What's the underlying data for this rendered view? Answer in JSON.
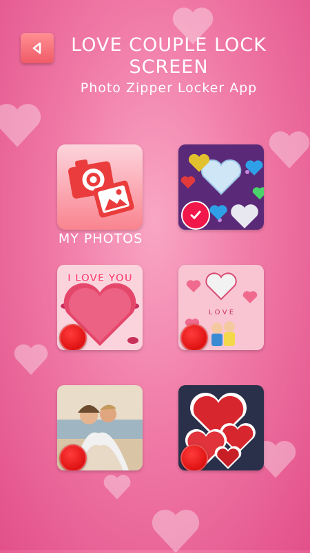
{
  "header": {
    "title": "LOVE COUPLE LOCK SCREEN",
    "subtitle": "Photo Zipper Locker App"
  },
  "back_button": {
    "icon": "back-arrow-icon"
  },
  "grid": {
    "my_photos_label": "MY PHOTOS",
    "selected_index": 1,
    "tiles": [
      {
        "id": "my-photos",
        "icon": "camera-photo-icon"
      },
      {
        "id": "diamond-hearts",
        "selected": true
      },
      {
        "id": "i-love-you-heart",
        "text": "I LOVE YOU"
      },
      {
        "id": "love-kids"
      },
      {
        "id": "couple-beach"
      },
      {
        "id": "red-hearts"
      }
    ]
  },
  "colors": {
    "accent": "#f2174a",
    "background": "#f07aa6",
    "dot_red": "#e00000"
  }
}
